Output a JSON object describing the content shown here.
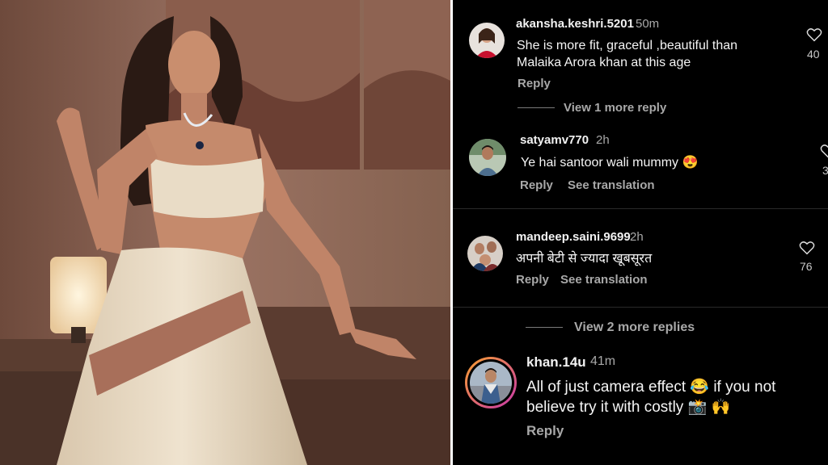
{
  "photo": {
    "alt": "photo-of-woman-in-embellished-lehenga"
  },
  "comments": [
    {
      "username": "akansha.keshri.5201",
      "time": "50m",
      "text_line1": "She is more fit, graceful ,beautiful than",
      "text_line2": "Malaika Arora khan at this age",
      "reply": "Reply",
      "likes": "40",
      "view_more": "View 1 more reply"
    },
    {
      "username": "satyamv770",
      "time": "2h",
      "text": "Ye hai santoor wali mummy 😍",
      "reply": "Reply",
      "see_translation": "See translation",
      "likes": "3"
    },
    {
      "username": "mandeep.saini.9699",
      "time": "2h",
      "text": "अपनी बेटी से ज्यादा खूबसूरत",
      "reply": "Reply",
      "see_translation": "See translation",
      "likes": "76",
      "view_more": "View 2 more replies"
    },
    {
      "username": "khan.14u",
      "time": "41m",
      "text_line1": "All of just camera effect 😂 if you not",
      "text_line2": "believe try it with costly 📸 🙌",
      "reply": "Reply"
    }
  ],
  "colors": {
    "background": "#000000",
    "secondary_text": "#a8a8a8",
    "story_ring_start": "#f9a12e",
    "story_ring_end": "#c837ab"
  }
}
